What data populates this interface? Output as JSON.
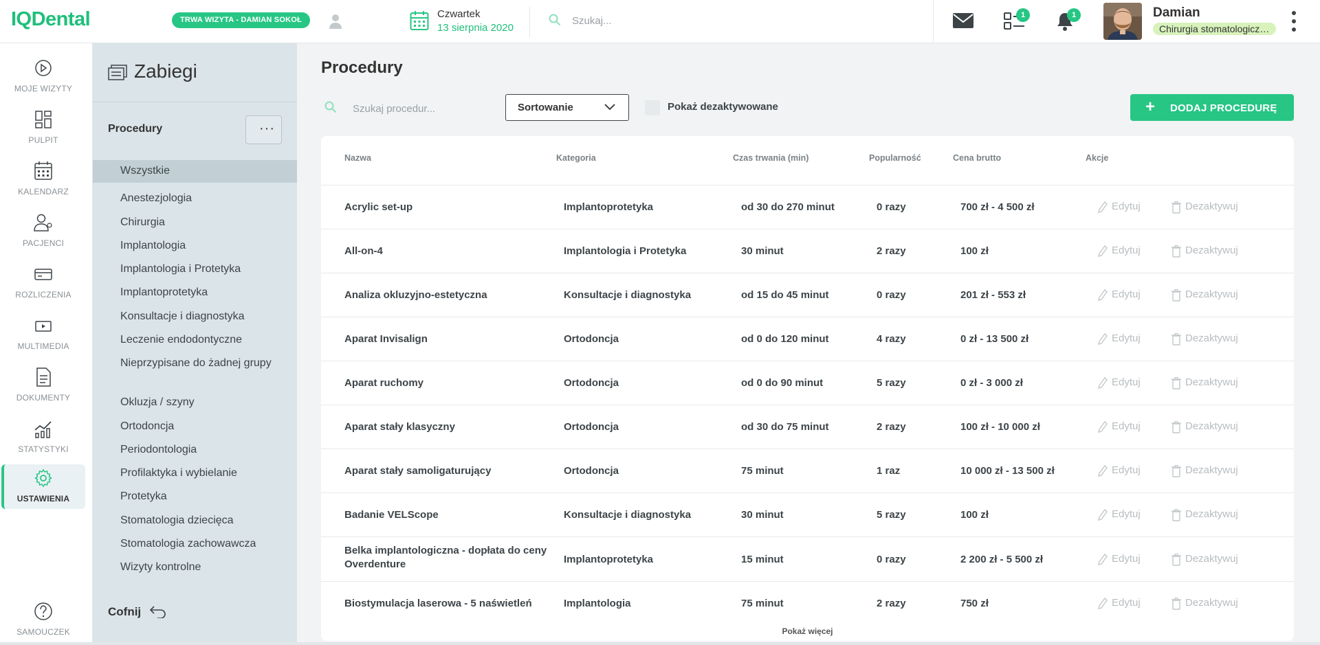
{
  "app": {
    "logo": "IQDental"
  },
  "header": {
    "visit_badge": "TRWA WIZYTA - DAMIAN SOKOŁ",
    "day": "Czwartek",
    "date": "13 sierpnia 2020",
    "search_placeholder": "Szukaj...",
    "tasks_count": "1",
    "notifications_count": "1",
    "user_name": "Damian",
    "user_role": "Chirurgia stomatologiczna"
  },
  "nav": [
    {
      "label": "MOJE WIZYTY",
      "icon": "play-circle-icon"
    },
    {
      "label": "PULPIT",
      "icon": "dashboard-icon"
    },
    {
      "label": "KALENDARZ",
      "icon": "calendar-icon"
    },
    {
      "label": "PACJENCI",
      "icon": "patients-icon"
    },
    {
      "label": "ROZLICZENIA",
      "icon": "credit-card-icon"
    },
    {
      "label": "MULTIMEDIA",
      "icon": "multimedia-icon"
    },
    {
      "label": "DOKUMENTY",
      "icon": "document-icon"
    },
    {
      "label": "STATYSTYKI",
      "icon": "statistics-icon"
    },
    {
      "label": "USTAWIENIA",
      "icon": "settings-gear-icon"
    },
    {
      "label": "SAMOUCZEK",
      "icon": "help-icon"
    }
  ],
  "submenu": {
    "title": "Zabiegi",
    "section": "Procedury",
    "more": "···",
    "categories": [
      "Wszystkie",
      "Anestezjologia",
      "Chirurgia",
      "Implantologia",
      "Implantologia i Protetyka",
      "Implantoprotetyka",
      "Konsultacje i diagnostyka",
      "Leczenie endodontyczne",
      "Nieprzypisane do żadnej grupy",
      "Okluzja / szyny",
      "Ortodoncja",
      "Periodontologia",
      "Profilaktyka i wybielanie",
      "Protetyka",
      "Stomatologia dziecięca",
      "Stomatologia zachowawcza",
      "Wizyty kontrolne"
    ],
    "back": "Cofnij"
  },
  "main": {
    "title": "Procedury",
    "search_placeholder": "Szukaj procedur...",
    "sort_label": "Sortowanie",
    "show_deactivated": "Pokaż dezaktywowane",
    "add_button": "DODAJ PROCEDURĘ",
    "columns": [
      "Nazwa",
      "Kategoria",
      "Czas trwania (min)",
      "Popularność",
      "Cena brutto",
      "Akcje"
    ],
    "edit_label": "Edytuj",
    "deactivate_label": "Dezaktywuj",
    "show_more": "Pokaż więcej",
    "rows": [
      {
        "name": "Acrylic set-up",
        "category": "Implantoprotetyka",
        "duration": "od 30 do 270 minut",
        "popularity": "0 razy",
        "price": "700 zł - 4 500 zł"
      },
      {
        "name": "All-on-4",
        "category": "Implantologia i Protetyka",
        "duration": "30 minut",
        "popularity": "2 razy",
        "price": "100 zł"
      },
      {
        "name": "Analiza okluzyjno-estetyczna",
        "category": "Konsultacje i diagnostyka",
        "duration": "od 15 do 45 minut",
        "popularity": "0 razy",
        "price": "201 zł - 553 zł"
      },
      {
        "name": "Aparat Invisalign",
        "category": "Ortodoncja",
        "duration": "od 0 do 120 minut",
        "popularity": "4 razy",
        "price": "0 zł - 13 500 zł"
      },
      {
        "name": "Aparat ruchomy",
        "category": "Ortodoncja",
        "duration": "od 0 do 90 minut",
        "popularity": "5 razy",
        "price": "0 zł - 3 000 zł"
      },
      {
        "name": "Aparat stały klasyczny",
        "category": "Ortodoncja",
        "duration": "od 30 do 75 minut",
        "popularity": "2 razy",
        "price": "100 zł - 10 000 zł"
      },
      {
        "name": "Aparat stały samoligaturujący",
        "category": "Ortodoncja",
        "duration": "75 minut",
        "popularity": "1 raz",
        "price": "10 000 zł - 13 500 zł"
      },
      {
        "name": "Badanie VELScope",
        "category": "Konsultacje i diagnostyka",
        "duration": "30 minut",
        "popularity": "5 razy",
        "price": "100 zł"
      },
      {
        "name": "Belka implantologiczna - dopłata do ceny Overdenture",
        "category": "Implantoprotetyka",
        "duration": "15 minut",
        "popularity": "0 razy",
        "price": "2 200 zł - 5 500 zł"
      },
      {
        "name": "Biostymulacja laserowa - 5 naświetleń",
        "category": "Implantologia",
        "duration": "75 minut",
        "popularity": "2 razy",
        "price": "750 zł"
      }
    ]
  },
  "colors": {
    "accent": "#27c684",
    "submenu_bg": "#dbe4e8",
    "page_bg": "#f1f3f4"
  }
}
